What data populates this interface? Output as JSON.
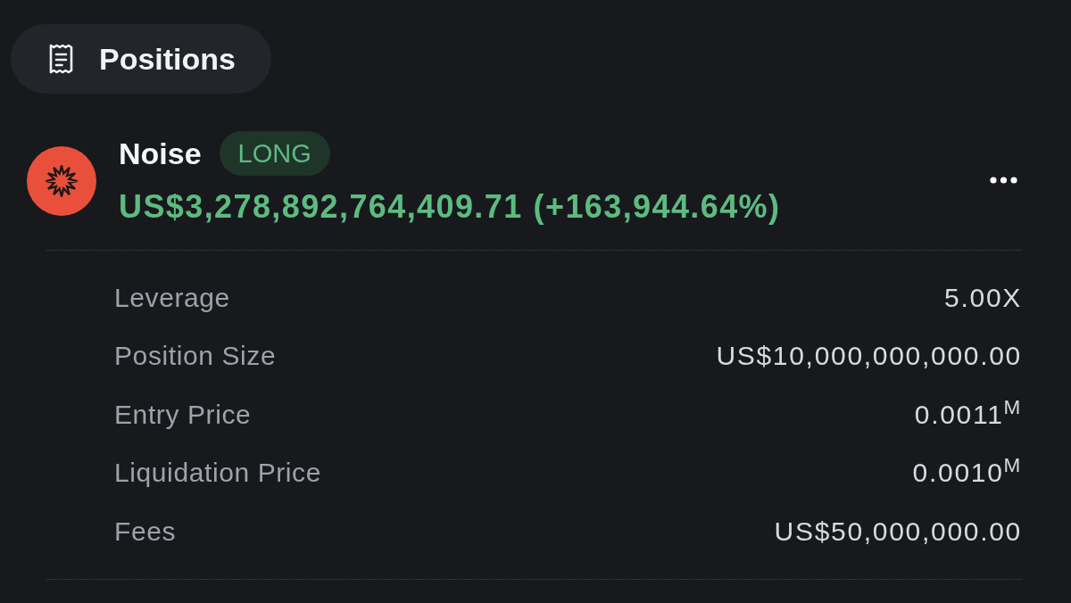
{
  "header": {
    "title": "Positions"
  },
  "position": {
    "market": "Noise",
    "side": {
      "label": "LONG",
      "kind": "long"
    },
    "gain": true,
    "pnl": "US$3,278,892,764,409.71",
    "pnl_percent": "(+163,944.64%)"
  },
  "details": [
    {
      "label": "Leverage",
      "value": "5.00X"
    },
    {
      "label": "Position Size",
      "value": "US$10,000,000,000.00"
    },
    {
      "label": "Entry Price",
      "value": "0.0011$^{M}$"
    },
    {
      "label": "Liquidation Price",
      "value": "0.0010$^{M}$"
    },
    {
      "label": "Fees",
      "value": "US$50,000,000.00"
    }
  ]
}
